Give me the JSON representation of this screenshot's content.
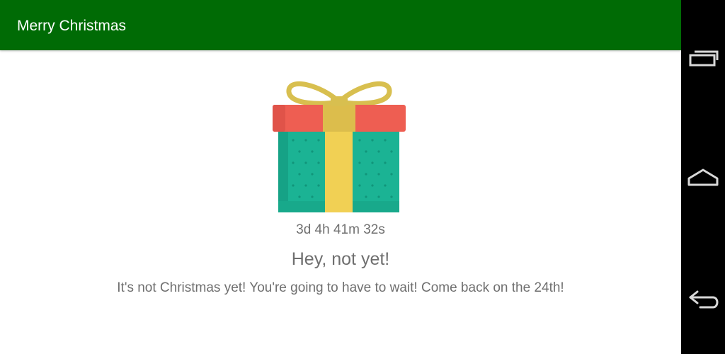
{
  "app": {
    "title": "Merry Christmas"
  },
  "main": {
    "countdown": "3d 4h 41m 32s",
    "heading": "Hey, not yet!",
    "message": "It's not Christmas yet! You're going to have to wait! Come back on the 24th!",
    "gift_icon": "gift-box-icon"
  },
  "colors": {
    "toolbar": "#006b05",
    "box": "#1bb394",
    "lid": "#ee5e52",
    "ribbon": "#f1d054",
    "text": "#6f6f6f"
  },
  "navbar": {
    "buttons": [
      "recent-apps-icon",
      "home-icon",
      "back-icon"
    ]
  }
}
